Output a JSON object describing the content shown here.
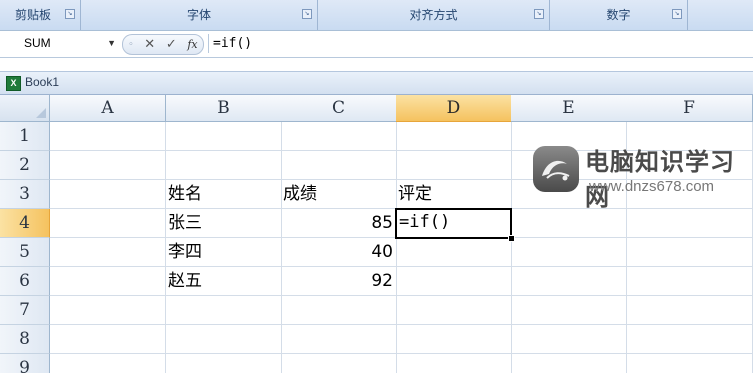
{
  "ribbon": {
    "groups": [
      {
        "label": "剪贴板",
        "has_launcher": true
      },
      {
        "label": "字体",
        "has_launcher": true
      },
      {
        "label": "对齐方式",
        "has_launcher": true
      },
      {
        "label": "数字",
        "has_launcher": true
      },
      {
        "label": "",
        "has_launcher": false
      }
    ]
  },
  "formula_bar": {
    "name_box": "SUM",
    "cancel_symbol": "✕",
    "enter_symbol": "✓",
    "fx_label": "fx",
    "content": "=if()"
  },
  "workbook": {
    "title": "Book1",
    "icon": "excel-workbook-icon"
  },
  "grid": {
    "columns": [
      "A",
      "B",
      "C",
      "D",
      "E",
      "F"
    ],
    "rows": [
      "1",
      "2",
      "3",
      "4",
      "5",
      "6",
      "7",
      "8",
      "9"
    ],
    "active_column": "D",
    "active_row": "4",
    "cells": {
      "B3": "姓名",
      "C3": "成绩",
      "D3": "评定",
      "B4": "张三",
      "C4": "85",
      "D4": "=if()",
      "B5": "李四",
      "C5": "40",
      "B6": "赵五",
      "C6": "92"
    }
  },
  "watermark": {
    "title": "电脑知识学习网",
    "url": "www.dnzs678.com"
  },
  "colors": {
    "ribbon_text": "#24456f",
    "active_header": "#f5c25f",
    "grid_line": "#d4dde8"
  }
}
